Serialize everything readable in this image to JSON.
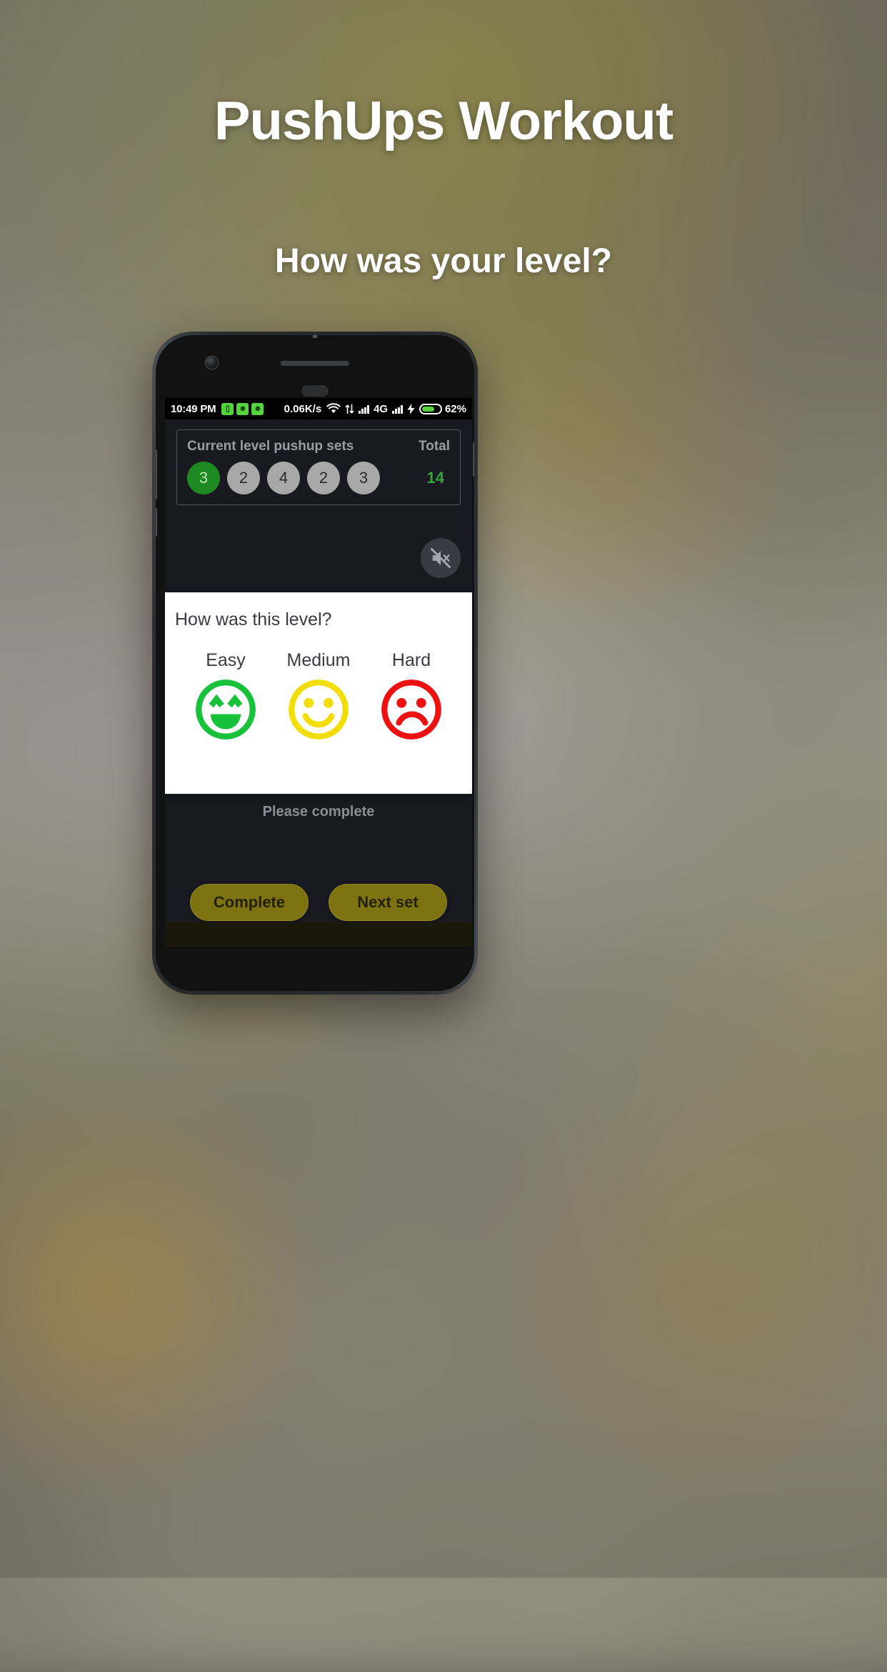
{
  "page": {
    "title": "PushUps Workout",
    "subtitle": "How was your level?"
  },
  "phone": {
    "statusbar": {
      "time": "10:49 PM",
      "icons_left": [
        "sim-icon",
        "android-icon",
        "android-icon"
      ],
      "data_rate": "0.06K/s",
      "wifi": "wifi-icon",
      "data_transfer": "data-transfer-icon",
      "signal_1": "signal-bars-icon",
      "network": "4G",
      "signal_2": "signal-bars-icon",
      "charging": "charging-bolt-icon",
      "battery": "battery-icon",
      "battery_percent": "62%"
    },
    "sets_card": {
      "title": "Current level pushup sets",
      "total_label": "Total",
      "sets": [
        {
          "value": "3",
          "active": true
        },
        {
          "value": "2",
          "active": false
        },
        {
          "value": "4",
          "active": false
        },
        {
          "value": "2",
          "active": false
        },
        {
          "value": "3",
          "active": false
        }
      ],
      "total_value": "14"
    },
    "mute_button": {
      "icon": "volume-muted-icon"
    },
    "dialog": {
      "title": "How was this level?",
      "options": [
        {
          "label": "Easy",
          "face": "happy-face-icon",
          "color": "#18c13a"
        },
        {
          "label": "Medium",
          "face": "neutral-smile-icon",
          "color": "#f2dd06"
        },
        {
          "label": "Hard",
          "face": "sad-face-icon",
          "color": "#ee1111"
        }
      ]
    },
    "status_message": "Please complete",
    "buttons": {
      "complete": "Complete",
      "next_set": "Next set"
    }
  },
  "colors": {
    "accent_green": "#2fa83a",
    "bubble_active": "#1f8a22",
    "bubble_inactive": "#a8a8a8",
    "button_olive": "#7e7311",
    "screen_bg": "#191922",
    "dialog_bg": "#ffffff"
  }
}
